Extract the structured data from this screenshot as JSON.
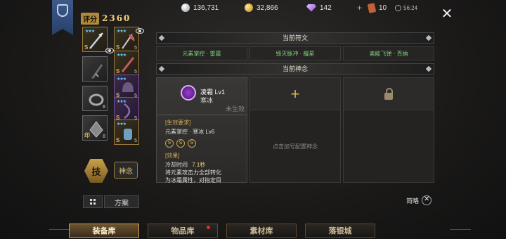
{
  "rating": {
    "label": "评分",
    "value": "2360"
  },
  "currencies": {
    "silver": "136,731",
    "gold": "32,866",
    "gems": "142",
    "tickets": "10",
    "timer": "56:24"
  },
  "equipment_left": [
    {
      "stars": "★★★",
      "tag": "S",
      "lvl": "",
      "color": "#b4bed0"
    },
    {
      "stars": "",
      "tag": "",
      "lvl": "",
      "color": "#777"
    },
    {
      "stars": "",
      "tag": "",
      "lvl": "8",
      "color": "#999"
    },
    {
      "stars": "",
      "tag": "印",
      "lvl": "8",
      "color": "#aaa"
    }
  ],
  "equipment_right": [
    {
      "stars": "★★★",
      "tag": "S",
      "lvl": "5",
      "color": "#c95a5a"
    },
    {
      "stars": "★★★",
      "tag": "S",
      "lvl": "5",
      "color": "#c95a5a"
    },
    {
      "stars": "★★★",
      "tag": "S",
      "lvl": "5",
      "color": "#8a6fb0"
    },
    {
      "stars": "★★★",
      "tag": "S",
      "lvl": "5",
      "color": "#8a6fb0"
    },
    {
      "stars": "★★★",
      "tag": "S",
      "lvl": "5",
      "color": "#6fa0c0"
    }
  ],
  "buttons": {
    "skill": "技",
    "spirit": "神念",
    "plan": "方案",
    "simple": "简略"
  },
  "runes": {
    "header": "当前符文",
    "items": [
      "元素掌控 · 雷霆",
      "毁灭脉冲 · 耀星",
      "奥能飞弹 · 百纳"
    ]
  },
  "spirits": {
    "header": "当前神念",
    "card": {
      "name": "凌霜 Lv1",
      "element": "寒冰",
      "status": "未生效",
      "req_head": "[生效要求]",
      "req_text": "元素掌控 · 寒冰 Lv6",
      "badge": "S",
      "effect_head": "[效果]",
      "cooldown_label": "冷却时间",
      "cooldown_value": "7.1秒",
      "effect_line1": "将元素攻击力全部转化",
      "effect_line2": "为冰霜属性，对指定目"
    },
    "add_hint": "点击加号配置神念"
  },
  "tabs": [
    {
      "label": "装备库",
      "active": true
    },
    {
      "label": "物品库",
      "active": false
    },
    {
      "label": "素材库",
      "active": false
    },
    {
      "label": "落银城",
      "active": false
    }
  ]
}
